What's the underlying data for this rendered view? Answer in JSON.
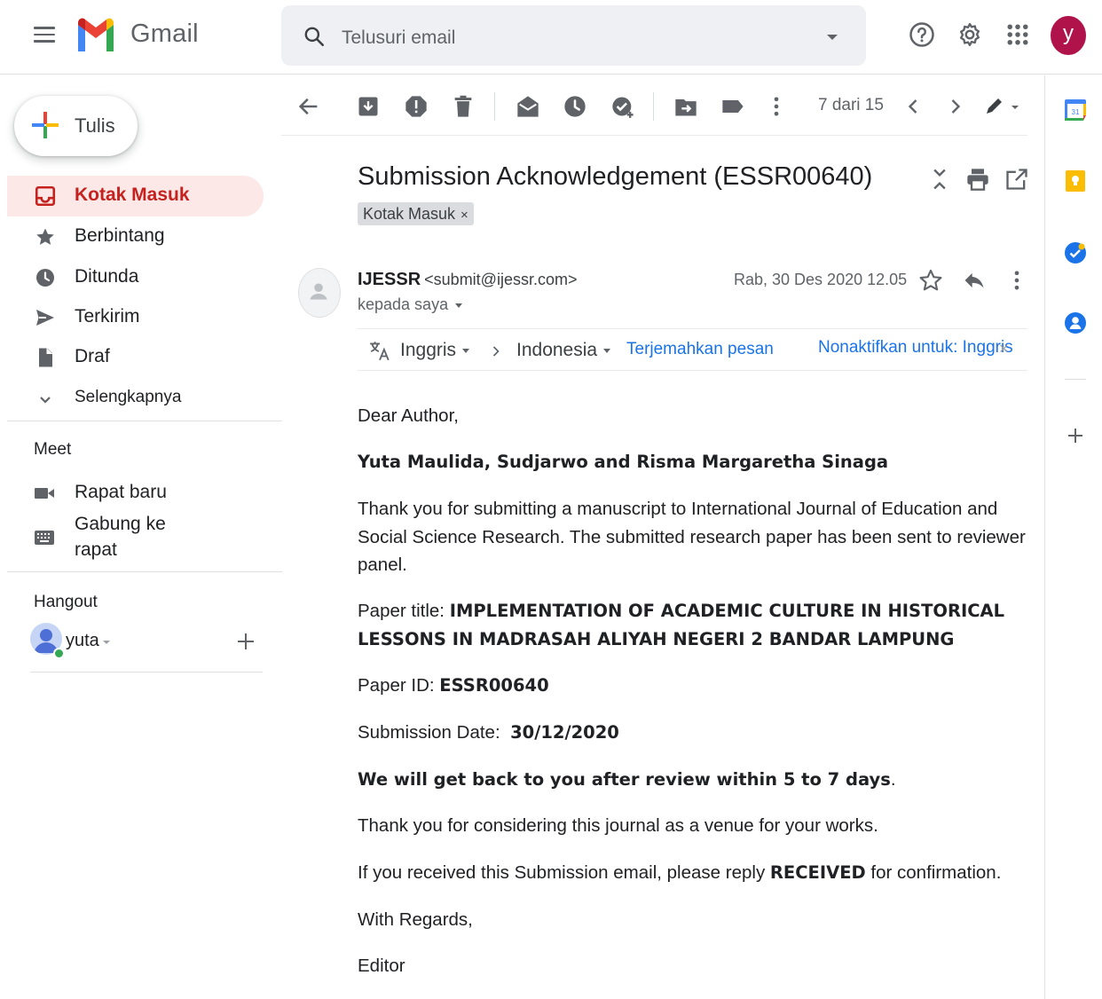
{
  "header": {
    "app_name": "Gmail",
    "search_placeholder": "Telusuri email",
    "avatar_letter": "y"
  },
  "compose": {
    "label": "Tulis"
  },
  "nav": {
    "items": [
      {
        "label": "Kotak Masuk",
        "icon": "inbox-icon",
        "active": true
      },
      {
        "label": "Berbintang",
        "icon": "star-icon"
      },
      {
        "label": "Ditunda",
        "icon": "clock-icon"
      },
      {
        "label": "Terkirim",
        "icon": "send-icon"
      },
      {
        "label": "Draf",
        "icon": "draft-icon"
      },
      {
        "label": "Selengkapnya",
        "icon": "chevron-down-icon"
      }
    ]
  },
  "meet": {
    "title": "Meet",
    "new_meeting": "Rapat baru",
    "join_meeting": "Gabung ke rapat"
  },
  "hangout": {
    "title": "Hangout",
    "user": "yuta"
  },
  "toolbar": {
    "count": "7 dari 15"
  },
  "message": {
    "subject": "Submission Acknowledgement (ESSR00640)",
    "label_chip": "Kotak Masuk",
    "label_chip_close": "×",
    "sender_name": "IJESSR",
    "sender_email": "<submit@ijessr.com>",
    "to": "kepada saya",
    "date": "Rab, 30 Des 2020 12.05"
  },
  "translate": {
    "from": "Inggris",
    "to": "Indonesia",
    "translate_link": "Terjemahkan pesan",
    "disable_link": "Nonaktifkan untuk: Inggris",
    "close": "×"
  },
  "body": {
    "greeting": "Dear Author,",
    "authors": "Yuta Maulida, Sudjarwo and Risma Margaretha Sinaga",
    "intro": "Thank you for submitting a manuscript to International Journal of Education and Social Science Research. The submitted research paper has been sent to reviewer panel.",
    "paper_title_label": "Paper title: ",
    "paper_title": "IMPLEMENTATION OF ACADEMIC CULTURE IN HISTORICAL LESSONS IN MADRASAH ALIYAH NEGERI 2 BANDAR LAMPUNG",
    "paper_id_label": "Paper ID: ",
    "paper_id": "ESSR00640",
    "submission_date_label": "Submission Date:  ",
    "submission_date": "30/12/2020",
    "review_note": "We will get back to you after review within 5 to 7 days",
    "review_note_end": ".",
    "thanks": "Thank you for considering this journal as a venue for your works.",
    "reply_pre": "If you received this Submission email, please reply ",
    "reply_bold": "RECEIVED",
    "reply_post": " for confirmation.",
    "regards": "With Regards,",
    "signature": "Editor"
  },
  "side_panel": {
    "calendar_day": "31"
  },
  "colors": {
    "active_nav_bg": "#fce8e6",
    "active_nav_text": "#c5221f",
    "link": "#1a73e8",
    "avatar": "#b0134a"
  }
}
